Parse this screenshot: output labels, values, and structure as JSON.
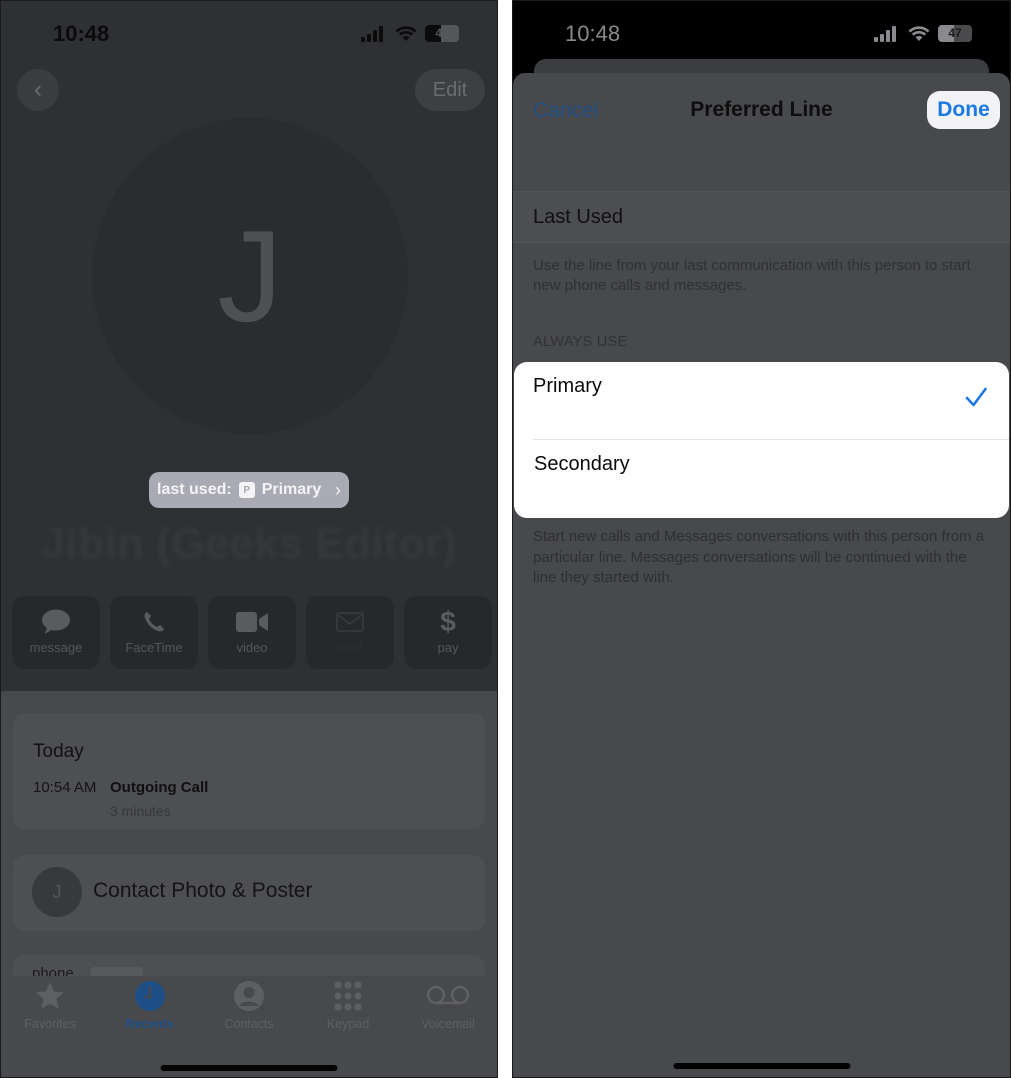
{
  "left_phone": {
    "status_bar": {
      "time": "10:48",
      "battery": "47"
    },
    "nav": {
      "back_icon": "chevron-left-icon",
      "edit_label": "Edit"
    },
    "contact": {
      "initial": "J",
      "name": "Jibin (Geeks Editor)",
      "last_used_label": "last used:",
      "line_badge": "P",
      "last_used_line": "Primary"
    },
    "actions": [
      {
        "label": "message",
        "icon": "message-bubble-icon"
      },
      {
        "label": "FaceTime",
        "icon": "phone-icon"
      },
      {
        "label": "video",
        "icon": "video-camera-icon"
      },
      {
        "label": "mail",
        "icon": "envelope-icon"
      },
      {
        "label": "pay",
        "icon": "dollar-icon"
      }
    ],
    "recents": {
      "day": "Today",
      "time": "10:54 AM",
      "type": "Outgoing Call",
      "duration": "3 minutes"
    },
    "poster": {
      "initial": "J",
      "label": "Contact Photo & Poster"
    },
    "phone_row": {
      "label": "phone"
    },
    "tabs": [
      {
        "label": "Favorites",
        "icon": "star-icon",
        "active": false
      },
      {
        "label": "Recents",
        "icon": "clock-icon",
        "active": true
      },
      {
        "label": "Contacts",
        "icon": "person-circle-icon",
        "active": false
      },
      {
        "label": "Keypad",
        "icon": "keypad-icon",
        "active": false
      },
      {
        "label": "Voicemail",
        "icon": "voicemail-icon",
        "active": false
      }
    ]
  },
  "right_phone": {
    "status_bar": {
      "time": "10:48",
      "battery": "47"
    },
    "sheet": {
      "cancel_label": "Cancel",
      "title": "Preferred Line",
      "done_label": "Done",
      "last_used_option": "Last Used",
      "last_used_description": "Use the line from your last communication with this person to start new phone calls and messages.",
      "section_header": "ALWAYS USE",
      "options": [
        {
          "label": "Primary",
          "selected": true
        },
        {
          "label": "Secondary",
          "selected": false
        }
      ],
      "always_use_description": "Start new calls and Messages conversations with this person from a particular line. Messages conversations will be continued with the line they started with."
    }
  },
  "colors": {
    "accent_blue": "#1b79e3",
    "recents_active": "#1d4f86",
    "dim_overlay_bg": "#48494c"
  }
}
